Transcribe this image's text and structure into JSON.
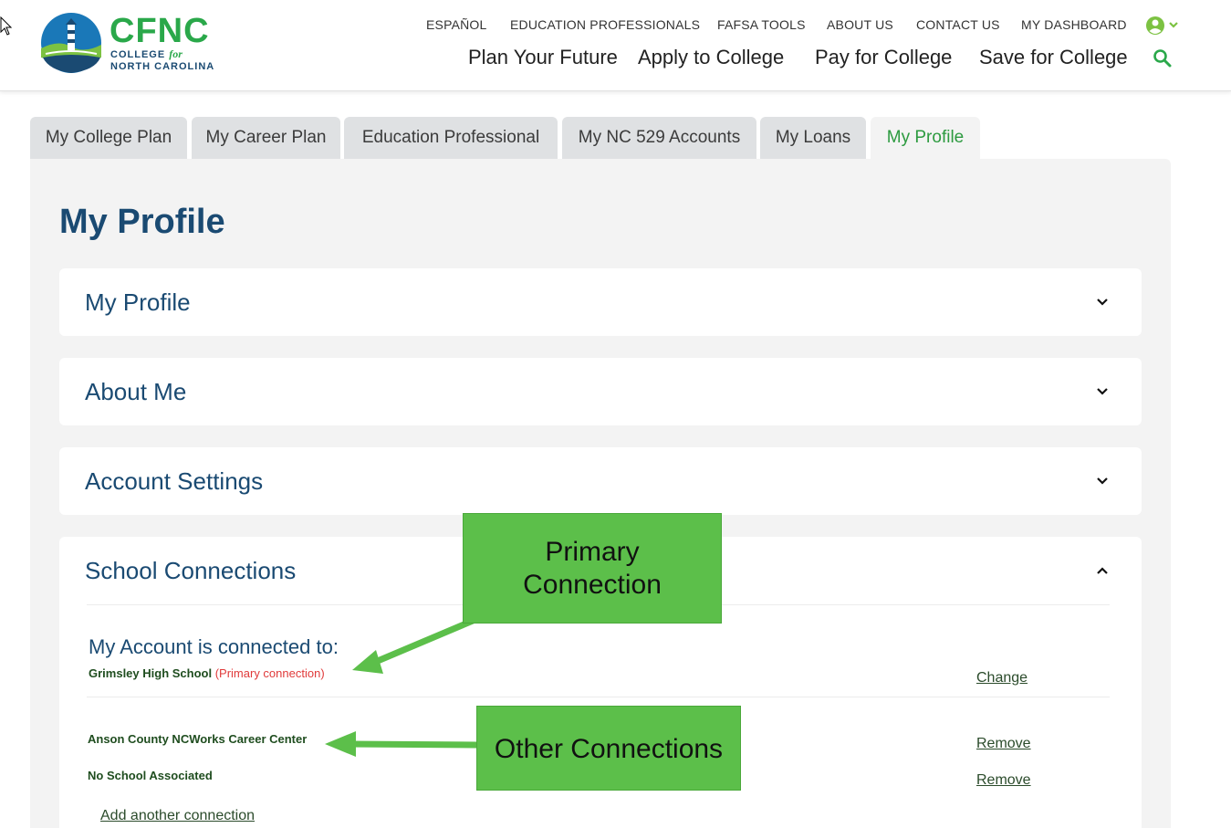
{
  "brand": {
    "title": "CFNC",
    "sub_line1_a": "COLLEGE ",
    "sub_line1_b": "for",
    "sub_line2": "NORTH CAROLINA"
  },
  "utility_nav": [
    {
      "label": "ESPAÑOL"
    },
    {
      "label": "EDUCATION PROFESSIONALS"
    },
    {
      "label": "FAFSA TOOLS"
    },
    {
      "label": "ABOUT US"
    },
    {
      "label": "CONTACT US"
    },
    {
      "label": "MY DASHBOARD"
    }
  ],
  "main_nav": [
    {
      "label": "Plan Your Future"
    },
    {
      "label": "Apply to College"
    },
    {
      "label": "Pay for College"
    },
    {
      "label": "Save for College"
    }
  ],
  "tabs": [
    {
      "label": "My College Plan"
    },
    {
      "label": "My Career Plan"
    },
    {
      "label": "Education Professional"
    },
    {
      "label": "My NC 529 Accounts"
    },
    {
      "label": "My Loans"
    },
    {
      "label": "My Profile",
      "active": true
    }
  ],
  "page_title": "My Profile",
  "accordions": [
    {
      "title": "My Profile",
      "expanded": false
    },
    {
      "title": "About Me",
      "expanded": false
    },
    {
      "title": "Account Settings",
      "expanded": false
    },
    {
      "title": "School Connections",
      "expanded": true
    }
  ],
  "school_connections": {
    "heading": "My Account is connected to:",
    "primary_school": "Grimsley High School",
    "primary_note": "(Primary connection)",
    "change_label": "Change",
    "others": [
      {
        "name": "Anson County NCWorks Career Center",
        "action": "Remove"
      },
      {
        "name": "No School Associated",
        "action": "Remove"
      }
    ],
    "add_label": "Add another connection"
  },
  "annotations": {
    "primary_line1": "Primary",
    "primary_line2": "Connection",
    "other": "Other Connections"
  },
  "colors": {
    "brand_green": "#2aa84a",
    "brand_navy": "#1a4a72",
    "callout_green": "#5cbf4a",
    "primary_note_red": "#e03a3a"
  }
}
